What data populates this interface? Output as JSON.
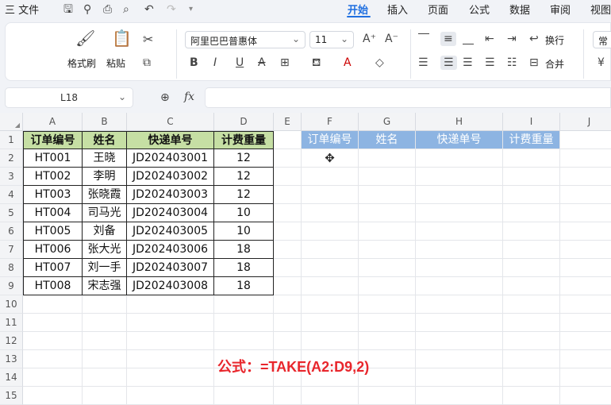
{
  "menubar": {
    "file_label": "三 文件",
    "tabs": [
      "开始",
      "插入",
      "页面",
      "公式",
      "数据",
      "审阅",
      "视图"
    ],
    "active_tab": "开始"
  },
  "ribbon": {
    "format_painter": "格式刷",
    "paste": "粘贴",
    "font_name": "阿里巴巴普惠体",
    "font_size": "11",
    "wrap": "换行",
    "merge": "合并",
    "number_format": "常"
  },
  "formula_bar": {
    "name_box": "L18",
    "fx": "fx",
    "formula": ""
  },
  "columns": [
    "A",
    "B",
    "C",
    "D",
    "E",
    "F",
    "G",
    "H",
    "I",
    "J"
  ],
  "rows": [
    "1",
    "2",
    "3",
    "4",
    "5",
    "6",
    "7",
    "8",
    "9",
    "10",
    "11",
    "12",
    "13",
    "14",
    "15"
  ],
  "source_table": {
    "headers": [
      "订单编号",
      "姓名",
      "快递单号",
      "计费重量"
    ],
    "rows": [
      [
        "HT001",
        "王晓",
        "JD202403001",
        "12"
      ],
      [
        "HT002",
        "李明",
        "JD202403002",
        "12"
      ],
      [
        "HT003",
        "张晓霞",
        "JD202403003",
        "12"
      ],
      [
        "HT004",
        "司马光",
        "JD202403004",
        "10"
      ],
      [
        "HT005",
        "刘备",
        "JD202403005",
        "10"
      ],
      [
        "HT006",
        "张大光",
        "JD202403006",
        "18"
      ],
      [
        "HT007",
        "刘一手",
        "JD202403007",
        "18"
      ],
      [
        "HT008",
        "宋志强",
        "JD202403008",
        "18"
      ]
    ]
  },
  "target_headers": [
    "订单编号",
    "姓名",
    "快递单号",
    "计费重量"
  ],
  "formula_note": "公式：=TAKE(A2:D9,2)",
  "colors": {
    "accent": "#1f6fe0",
    "source_header": "#c6dfa4",
    "target_header": "#8db4e2",
    "note": "#e8262c"
  }
}
